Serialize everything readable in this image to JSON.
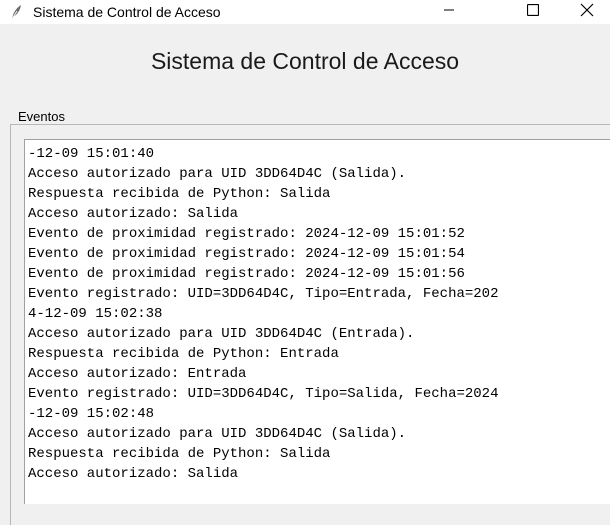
{
  "window": {
    "title": "Sistema de Control de Acceso",
    "icon": "feather-icon",
    "controls": [
      "minimize-icon",
      "maximize-icon",
      "close-icon"
    ]
  },
  "header": {
    "title": "Sistema de Control de Acceso"
  },
  "events": {
    "label": "Eventos",
    "lines": [
      "-12-09 15:01:40",
      "Acceso autorizado para UID 3DD64D4C (Salida).",
      "Respuesta recibida de Python: Salida",
      "Acceso autorizado: Salida",
      "Evento de proximidad registrado: 2024-12-09 15:01:52",
      "Evento de proximidad registrado: 2024-12-09 15:01:54",
      "Evento de proximidad registrado: 2024-12-09 15:01:56",
      "Evento registrado: UID=3DD64D4C, Tipo=Entrada, Fecha=202",
      "4-12-09 15:02:38",
      "Acceso autorizado para UID 3DD64D4C (Entrada).",
      "Respuesta recibida de Python: Entrada",
      "Acceso autorizado: Entrada",
      "Evento registrado: UID=3DD64D4C, Tipo=Salida, Fecha=2024",
      "-12-09 15:02:48",
      "Acceso autorizado para UID 3DD64D4C (Salida).",
      "Respuesta recibida de Python: Salida",
      "Acceso autorizado: Salida"
    ]
  }
}
